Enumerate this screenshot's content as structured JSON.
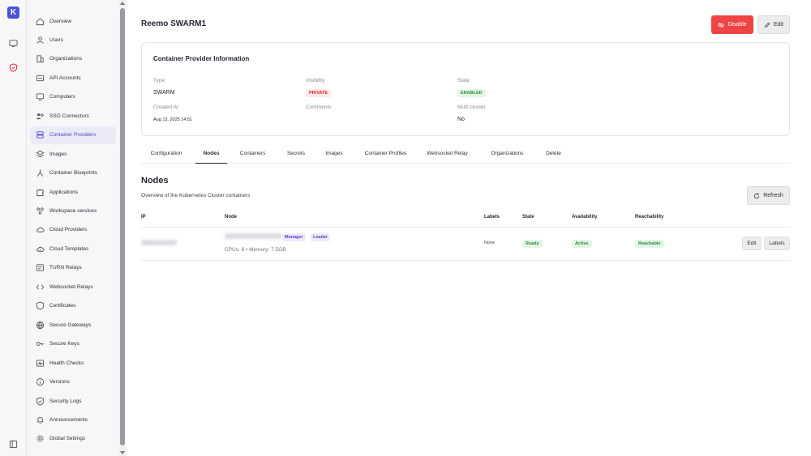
{
  "sidebar": {
    "items": [
      {
        "label": "Overview",
        "icon": "home-icon"
      },
      {
        "label": "Users",
        "icon": "user-icon"
      },
      {
        "label": "Organizations",
        "icon": "building-icon"
      },
      {
        "label": "API Accounts",
        "icon": "api-icon"
      },
      {
        "label": "Computers",
        "icon": "monitor-icon"
      },
      {
        "label": "SSO Connectors",
        "icon": "users-icon"
      },
      {
        "label": "Container Providers",
        "icon": "server-icon"
      },
      {
        "label": "Images",
        "icon": "layers-icon"
      },
      {
        "label": "Container Blueprints",
        "icon": "blueprint-icon"
      },
      {
        "label": "Applications",
        "icon": "puzzle-icon"
      },
      {
        "label": "Workspace services",
        "icon": "services-icon"
      },
      {
        "label": "Cloud Providers",
        "icon": "cloud-icon"
      },
      {
        "label": "Cloud Templates",
        "icon": "cloud-template-icon"
      },
      {
        "label": "TURN Relays",
        "icon": "relay-icon"
      },
      {
        "label": "Websocket Relays",
        "icon": "code-icon"
      },
      {
        "label": "Certificates",
        "icon": "certificate-icon"
      },
      {
        "label": "Secure Gateways",
        "icon": "globe-icon"
      },
      {
        "label": "Secure Keys",
        "icon": "key-icon"
      },
      {
        "label": "Health Checks",
        "icon": "health-icon"
      },
      {
        "label": "Versions",
        "icon": "info-icon"
      },
      {
        "label": "Security Logs",
        "icon": "shield-icon"
      },
      {
        "label": "Announcements",
        "icon": "bell-icon"
      },
      {
        "label": "Global Settings",
        "icon": "gear-icon"
      }
    ]
  },
  "header": {
    "title": "Reemo SWARM1",
    "disable_label": "Disable",
    "edit_label": "Edit"
  },
  "info": {
    "title": "Container Provider Information",
    "type_label": "Type",
    "type_value": "SWARM",
    "visibility_label": "Visibility",
    "visibility_value": "PRIVATE",
    "state_label": "State",
    "state_value": "ENABLED",
    "created_label": "Created At",
    "created_value": "Aug 13, 2025 14:51",
    "comments_label": "Comments",
    "multicluster_label": "Multi cluster",
    "multicluster_value": "No"
  },
  "tabs": [
    "Configuration",
    "Nodes",
    "Containers",
    "Secrets",
    "Images",
    "Container Profiles",
    "Websocket Relay",
    "Organizations",
    "Delete"
  ],
  "nodes": {
    "title": "Nodes",
    "subtitle": "Overview of the Kubernetes Cluster containers",
    "refresh_label": "Refresh",
    "columns": {
      "ip": "IP",
      "node": "Node",
      "labels": "Labels",
      "state": "State",
      "availability": "Availability",
      "reachability": "Reachability"
    },
    "rows": [
      {
        "tag_manager": "Manager",
        "tag_leader": "Leader",
        "specs": "CPUs: 8 • Memory: 7.5GB",
        "labels": "None",
        "state": "Ready",
        "availability": "Active",
        "reachability": "Reachable",
        "edit_label": "Edit",
        "labels_button": "Labels"
      }
    ]
  },
  "colors": {
    "accent": "#4f46c8",
    "danger": "#ef4444",
    "success": "#2b8a3e"
  }
}
